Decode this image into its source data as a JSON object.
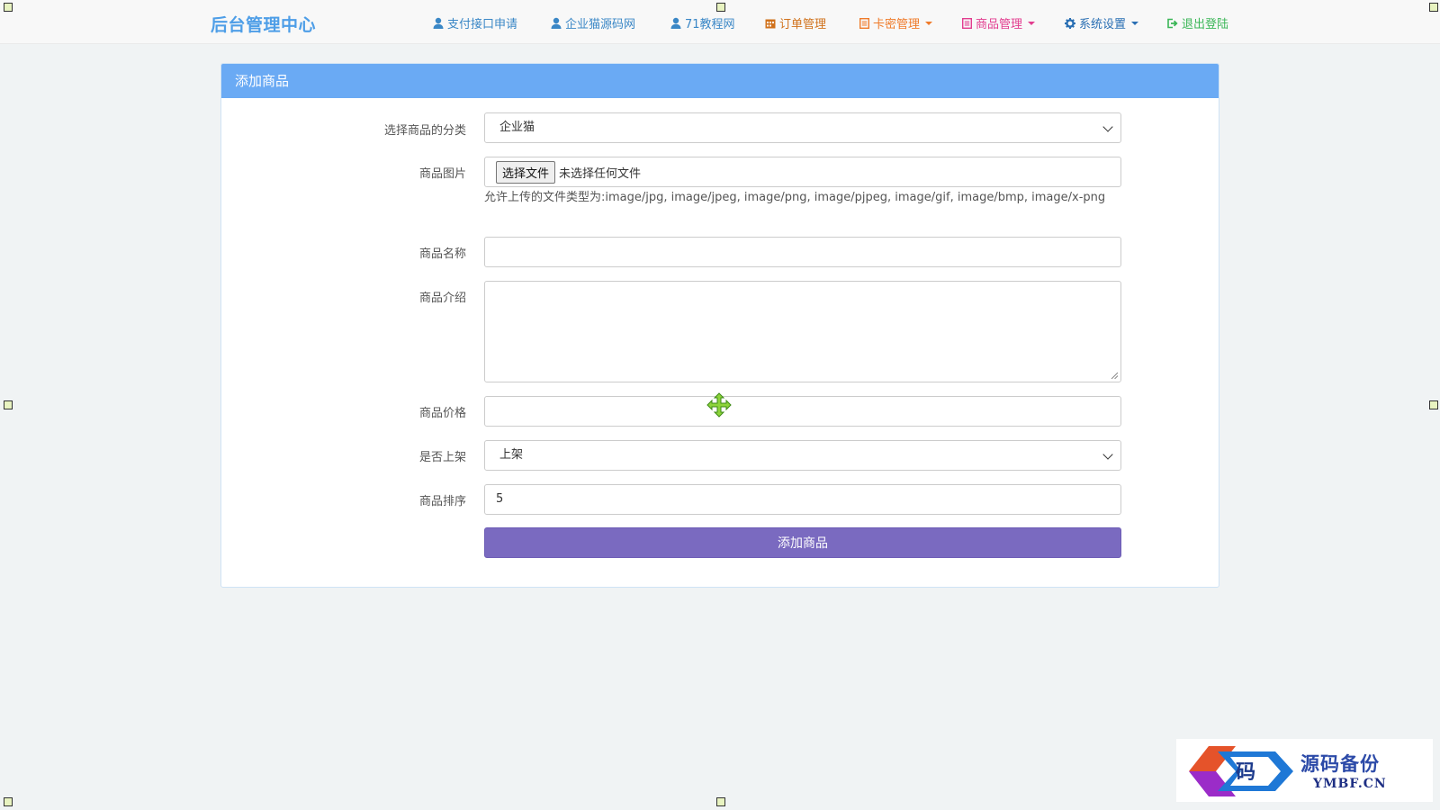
{
  "brand": "后台管理中心",
  "nav": [
    {
      "icon": "user-icon",
      "label": "支付接口申请",
      "color": "#3a87c6"
    },
    {
      "icon": "user-icon",
      "label": "企业猫源码网",
      "color": "#3a87c6"
    },
    {
      "icon": "user-icon",
      "label": "71教程网",
      "color": "#3a87c6"
    },
    {
      "icon": "calendar-icon",
      "label": "订单管理",
      "color": "#d0721c"
    },
    {
      "icon": "document-icon",
      "label": "卡密管理",
      "color": "#ef7b2a",
      "dropdown": true
    },
    {
      "icon": "document-icon",
      "label": "商品管理",
      "color": "#e23d8f",
      "dropdown": true
    },
    {
      "icon": "gear-icon",
      "label": "系统设置",
      "color": "#2a6fb3",
      "dropdown": true
    },
    {
      "icon": "logout-icon",
      "label": "退出登陆",
      "color": "#3bb657"
    }
  ],
  "panel": {
    "title": "添加商品",
    "category_label": "选择商品的分类",
    "category_value": "企业猫",
    "image_label": "商品图片",
    "file_button": "选择文件",
    "file_status": "未选择任何文件",
    "file_hint": "允许上传的文件类型为:image/jpg, image/jpeg, image/png, image/pjpeg, image/gif, image/bmp, image/x-png",
    "name_label": "商品名称",
    "name_value": "",
    "desc_label": "商品介绍",
    "desc_value": "",
    "price_label": "商品价格",
    "price_value": "",
    "status_label": "是否上架",
    "status_value": "上架",
    "sort_label": "商品排序",
    "sort_value": "5",
    "submit_label": "添加商品"
  },
  "watermark": {
    "text": "源码备份",
    "sub": "YMBF.CN"
  }
}
